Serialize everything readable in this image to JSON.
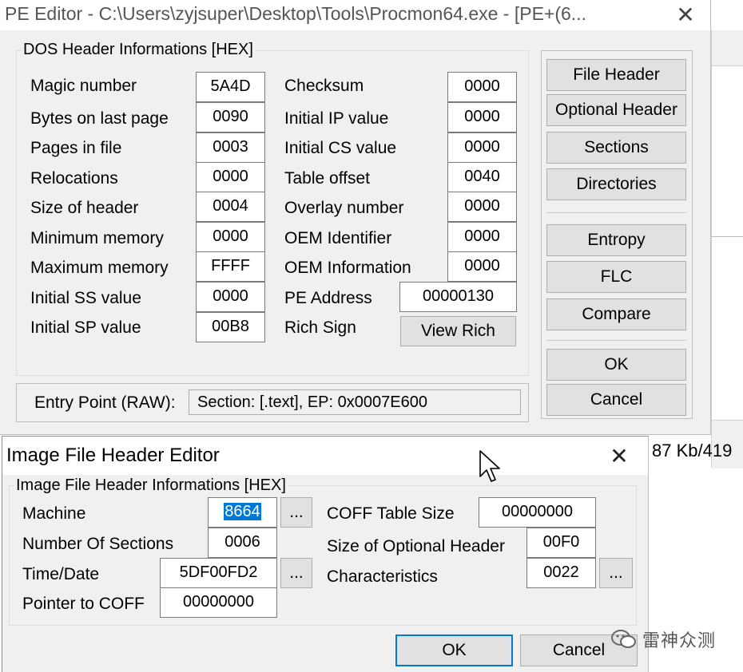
{
  "pe_editor": {
    "title": "PE Editor - C:\\Users\\zyjsuper\\Desktop\\Tools\\Procmon64.exe - [PE+(6...",
    "group_title": "DOS Header Informations [HEX]",
    "left_fields": [
      {
        "label": "Magic number",
        "value": "5A4D"
      },
      {
        "label": "Bytes on last page",
        "value": "0090"
      },
      {
        "label": "Pages in file",
        "value": "0003"
      },
      {
        "label": "Relocations",
        "value": "0000"
      },
      {
        "label": "Size of header",
        "value": "0004"
      },
      {
        "label": "Minimum memory",
        "value": "0000"
      },
      {
        "label": "Maximum memory",
        "value": "FFFF"
      },
      {
        "label": "Initial SS value",
        "value": "0000"
      },
      {
        "label": "Initial SP value",
        "value": "00B8"
      }
    ],
    "right_fields": [
      {
        "label": "Checksum",
        "value": "0000"
      },
      {
        "label": "Initial IP value",
        "value": "0000"
      },
      {
        "label": "Initial CS value",
        "value": "0000"
      },
      {
        "label": "Table offset",
        "value": "0040"
      },
      {
        "label": "Overlay number",
        "value": "0000"
      },
      {
        "label": "OEM Identifier",
        "value": "0000"
      },
      {
        "label": "OEM Information",
        "value": "0000"
      },
      {
        "label": "PE Address",
        "value": "00000130"
      },
      {
        "label": "Rich Sign",
        "button": "View Rich"
      }
    ],
    "entry_point_label": "Entry Point (RAW):",
    "entry_point_value": "Section: [.text], EP: 0x0007E600",
    "side_buttons": {
      "file_header": "File Header",
      "optional_header": "Optional Header",
      "sections": "Sections",
      "directories": "Directories",
      "entropy": "Entropy",
      "flc": "FLC",
      "compare": "Compare",
      "ok": "OK",
      "cancel": "Cancel"
    }
  },
  "background_text": "87 Kb/419",
  "image_file_header": {
    "title": "Image File Header Editor",
    "group_title": "Image File Header Informations [HEX]",
    "machine_label": "Machine",
    "machine_value": "8664",
    "num_sections_label": "Number Of Sections",
    "num_sections_value": "0006",
    "time_date_label": "Time/Date",
    "time_date_value": "5DF00FD2",
    "pointer_coff_label": "Pointer to COFF",
    "pointer_coff_value": "00000000",
    "coff_table_size_label": "COFF Table Size",
    "coff_table_size_value": "00000000",
    "size_optional_header_label": "Size of Optional Header",
    "size_optional_header_value": "00F0",
    "characteristics_label": "Characteristics",
    "characteristics_value": "0022",
    "ellipsis": "...",
    "ok_label": "OK",
    "cancel_label": "Cancel"
  },
  "watermark": "雷神众测"
}
